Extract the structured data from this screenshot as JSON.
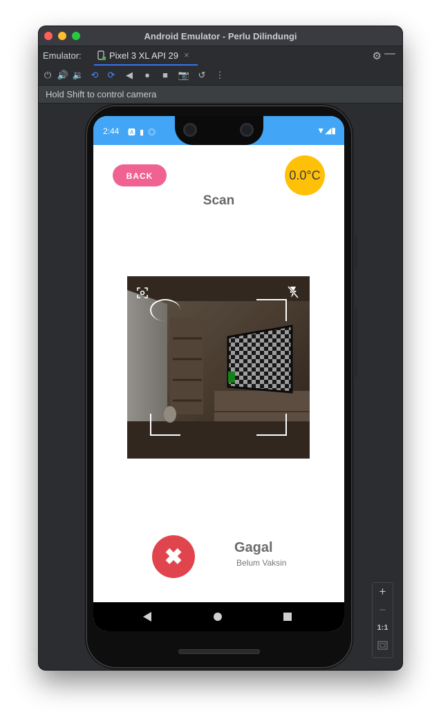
{
  "window": {
    "title": "Android Emulator - Perlu Dilindungi",
    "tab_prefix": "Emulator:",
    "tab_label": "Pixel 3 XL API 29",
    "tab_close": "×",
    "hint": "Hold Shift to control camera"
  },
  "toolbar": {
    "items": [
      "power",
      "volume-up",
      "volume-down",
      "rotate-left",
      "rotate-right",
      "back",
      "home",
      "overview",
      "screenshot",
      "snapshot",
      "more"
    ]
  },
  "statusbar": {
    "time": "2:44",
    "left_icons": [
      "notification-a-icon",
      "sd-card-icon",
      "sync-icon"
    ],
    "right_icons": [
      "wifi-icon",
      "signal-icon",
      "battery-icon"
    ]
  },
  "app": {
    "back_label": "BACK",
    "temperature": "0.0°C",
    "title": "Scan",
    "result_title": "Gagal",
    "result_subtitle": "Belum Vaksin",
    "fail_glyph": "✖"
  },
  "zoom_panel": {
    "plus": "+",
    "minus": "–",
    "one_to_one": "1:1"
  },
  "colors": {
    "statusbar": "#42a5f5",
    "back_button": "#f06292",
    "temperature_badge": "#ffc107",
    "fail": "#e0454d"
  }
}
